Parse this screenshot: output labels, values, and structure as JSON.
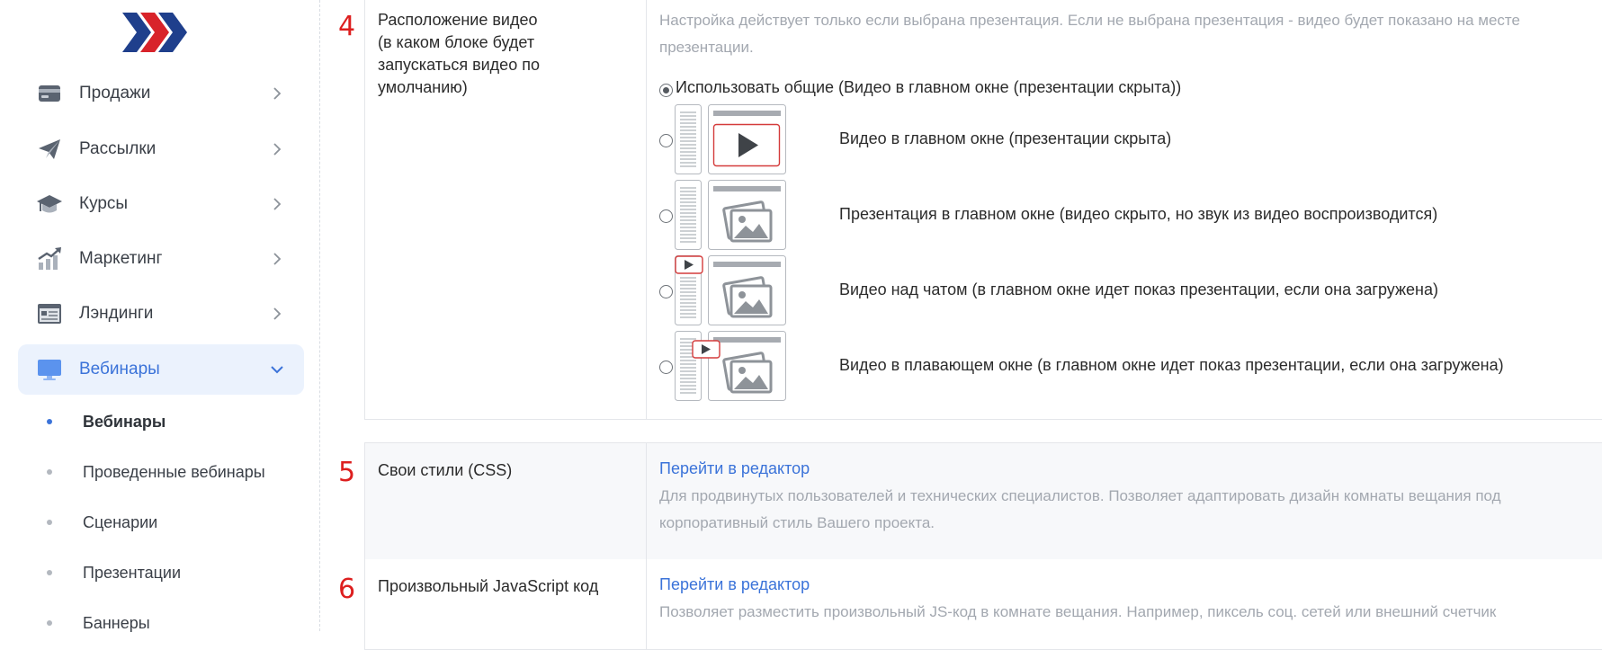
{
  "sidebar": {
    "logo_icon": "chevrons-logo-icon",
    "items": [
      {
        "label": "Продажи",
        "icon": "wallet-icon"
      },
      {
        "label": "Рассылки",
        "icon": "paper-plane-icon"
      },
      {
        "label": "Курсы",
        "icon": "graduation-cap-icon"
      },
      {
        "label": "Маркетинг",
        "icon": "chart-growth-icon"
      },
      {
        "label": "Лэндинги",
        "icon": "landing-page-icon"
      },
      {
        "label": "Вебинары",
        "icon": "monitor-icon",
        "active": true
      }
    ],
    "subitems": [
      {
        "label": "Вебинары",
        "active": true
      },
      {
        "label": "Проведенные вебинары"
      },
      {
        "label": "Сценарии"
      },
      {
        "label": "Презентации"
      },
      {
        "label": "Баннеры"
      }
    ]
  },
  "rows": {
    "video_position": {
      "number": "4",
      "label_lines": [
        "Расположение видео",
        "(в каком блоке будет",
        "запускаться видео по",
        "умолчанию)"
      ],
      "hint_line1": "Настройка действует только если выбрана презентация. Если не выбрана презентация - видео будет показано на месте",
      "hint_line2": "презентации.",
      "options": [
        {
          "label": "Использовать общие (Видео в главном окне (презентации скрыта))",
          "checked": true
        },
        {
          "label": "Видео в главном окне (презентации скрыта)",
          "checked": false
        },
        {
          "label": "Презентация в главном окне (видео скрыто, но звук из видео воспроизводится)",
          "checked": false
        },
        {
          "label": "Видео над чатом (в главном окне идет показ презентации, если она загружена)",
          "checked": false
        },
        {
          "label": "Видео в плавающем окне (в главном окне идет показ презентации, если она загружена)",
          "checked": false
        }
      ]
    },
    "custom_css": {
      "number": "5",
      "label": "Свои стили (CSS)",
      "link": "Перейти в редактор",
      "hint_line1": "Для продвинутых пользователей и технических специалистов. Позволяет адаптировать дизайн комнаты вещания под",
      "hint_line2": "корпоративный стиль Вашего проекта."
    },
    "custom_js": {
      "number": "6",
      "label": "Произвольный JavaScript код",
      "link": "Перейти в редактор",
      "hint_line1": "Позволяет разместить произвольный JS-код в комнате вещания. Например, пиксель соц. сетей или внешний счетчик"
    }
  },
  "colors": {
    "accent": "#3b73d9",
    "active_bg": "#ebf2fd",
    "row_number": "#dd1f1f",
    "logo_blue": "#1f3f8c",
    "logo_red": "#d8232a"
  }
}
